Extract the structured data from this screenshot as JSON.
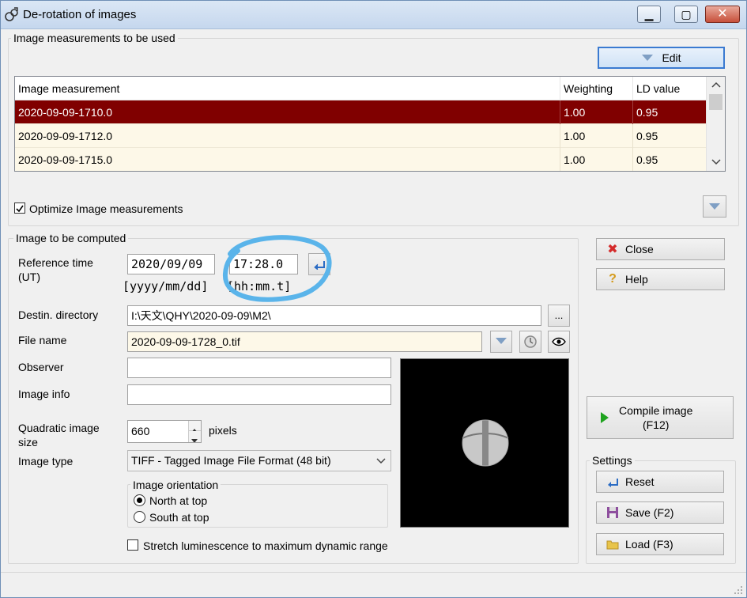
{
  "window": {
    "title": "De-rotation of images",
    "minimize": "▁",
    "maximize": "▢",
    "close": "✕"
  },
  "measurements_group": {
    "label": "Image measurements to be used",
    "edit_button": "Edit",
    "columns": [
      "Image measurement",
      "Weighting",
      "LD value"
    ],
    "rows": [
      {
        "name": "2020-09-09-1710.0",
        "weighting": "1.00",
        "ld": "0.95",
        "selected": true
      },
      {
        "name": "2020-09-09-1712.0",
        "weighting": "1.00",
        "ld": "0.95",
        "selected": false
      },
      {
        "name": "2020-09-09-1715.0",
        "weighting": "1.00",
        "ld": "0.95",
        "selected": false
      }
    ],
    "optimize_label": "Optimize Image measurements",
    "optimize_checked": true
  },
  "compute_group": {
    "label": "Image to be computed",
    "reference_time_label": "Reference time\n(UT)",
    "date_value": "2020/09/09",
    "time_value": "17:28.0",
    "date_format": "[yyyy/mm/dd]",
    "time_format": "[hh:mm.t]",
    "dest_dir_label": "Destin. directory",
    "dest_dir_value": "I:\\天文\\QHY\\2020-09-09\\M2\\",
    "browse_label": "...",
    "file_name_label": "File name",
    "file_name_value": "2020-09-09-1728_0.tif",
    "observer_label": "Observer",
    "observer_value": "",
    "image_info_label": "Image info",
    "image_info_value": "",
    "quad_size_label": "Quadratic image\nsize",
    "quad_size_value": "660",
    "pixels_label": "pixels",
    "image_type_label": "Image type",
    "image_type_value": "TIFF - Tagged Image File Format (48 bit)",
    "orientation_label": "Image orientation",
    "north_label": "North at top",
    "south_label": "South at top",
    "orientation_selected": "north",
    "stretch_label": "Stretch luminescence to maximum dynamic range",
    "stretch_checked": false
  },
  "side_buttons": {
    "close": "Close",
    "help": "Help",
    "compile": "Compile image\n(F12)",
    "settings_label": "Settings",
    "reset": "Reset",
    "save": "Save (F2)",
    "load": "Load (F3)"
  },
  "colors": {
    "selected_row": "#800000",
    "row_bg": "#fdf8e8",
    "annotation_circle": "#5ab4ea"
  }
}
